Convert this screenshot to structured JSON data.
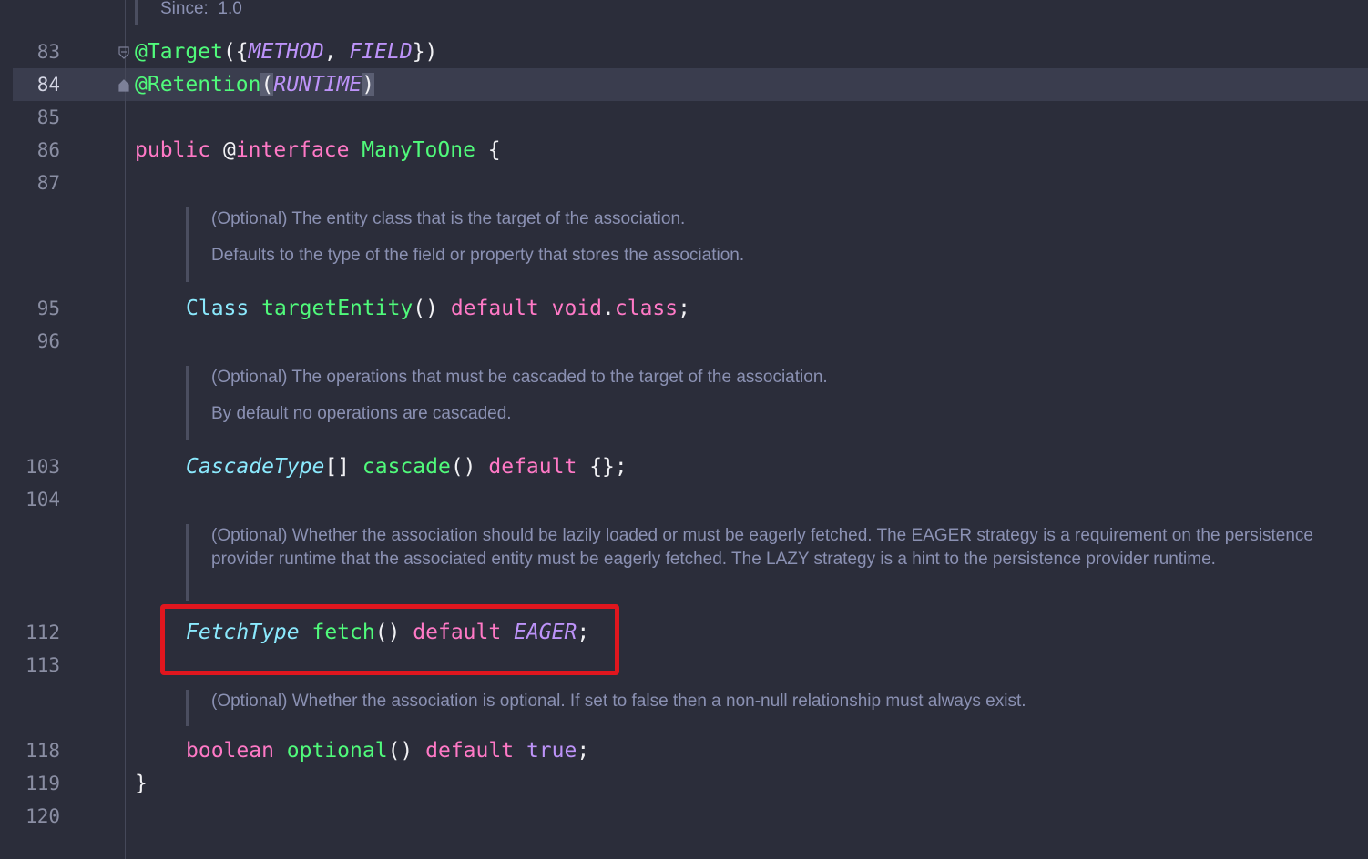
{
  "since": {
    "label": "Since:",
    "value": "1.0"
  },
  "colors": {
    "background": "#2b2d3a",
    "keyword": "#ff79c6",
    "type": "#8be9fd",
    "function": "#50fa7b",
    "constant": "#bd93f9",
    "doc_text": "#8b91b3",
    "highlight_box": "#e0161e"
  },
  "icons": {
    "fold_start": "fold-open-icon",
    "fold_end": "fold-close-icon"
  },
  "lines": [
    {
      "number": "83",
      "annotation": "@Target",
      "open": "({",
      "c1": "METHOD",
      "sep": ", ",
      "c2": "FIELD",
      "close": "})"
    },
    {
      "number": "84",
      "annotation": "@Retention",
      "open": "(",
      "c1": "RUNTIME",
      "close": ")"
    },
    {
      "number": "85"
    },
    {
      "number": "86",
      "kw1": "public",
      "at": "@",
      "kw2": "interface",
      "name": "ManyToOne",
      "brace": "{"
    },
    {
      "number": "87"
    },
    {
      "number": "95",
      "type": "Class",
      "method": "targetEntity",
      "parens": "()",
      "kw": "default",
      "kw2": "void",
      "dot": ".",
      "kw3": "class",
      "end": ";"
    },
    {
      "number": "96"
    },
    {
      "number": "103",
      "type": "CascadeType",
      "brackets": "[]",
      "method": "cascade",
      "parens": "()",
      "kw": "default",
      "rest": "{};"
    },
    {
      "number": "104"
    },
    {
      "number": "112",
      "type": "FetchType",
      "method": "fetch",
      "parens": "()",
      "kw": "default",
      "constant": "EAGER",
      "end": ";"
    },
    {
      "number": "113"
    },
    {
      "number": "118",
      "type": "boolean",
      "method": "optional",
      "parens": "()",
      "kw": "default",
      "value": "true",
      "end": ";"
    },
    {
      "number": "119",
      "brace": "}"
    },
    {
      "number": "120"
    }
  ],
  "docs": [
    {
      "p1": "(Optional) The entity class that is the target of the association.",
      "p2": "Defaults to the type of the field or property that stores the association."
    },
    {
      "p1": "(Optional) The operations that must be cascaded to the target of the association.",
      "p2": "By default no operations are cascaded."
    },
    {
      "p1": "(Optional) Whether the association should be lazily loaded or must be eagerly fetched. The EAGER strategy is a requirement on the persistence provider runtime that the associated entity must be eagerly fetched. The LAZY strategy is a hint to the persistence provider runtime."
    },
    {
      "p1": "(Optional) Whether the association is optional. If set to false then a non-null relationship must always exist."
    }
  ]
}
